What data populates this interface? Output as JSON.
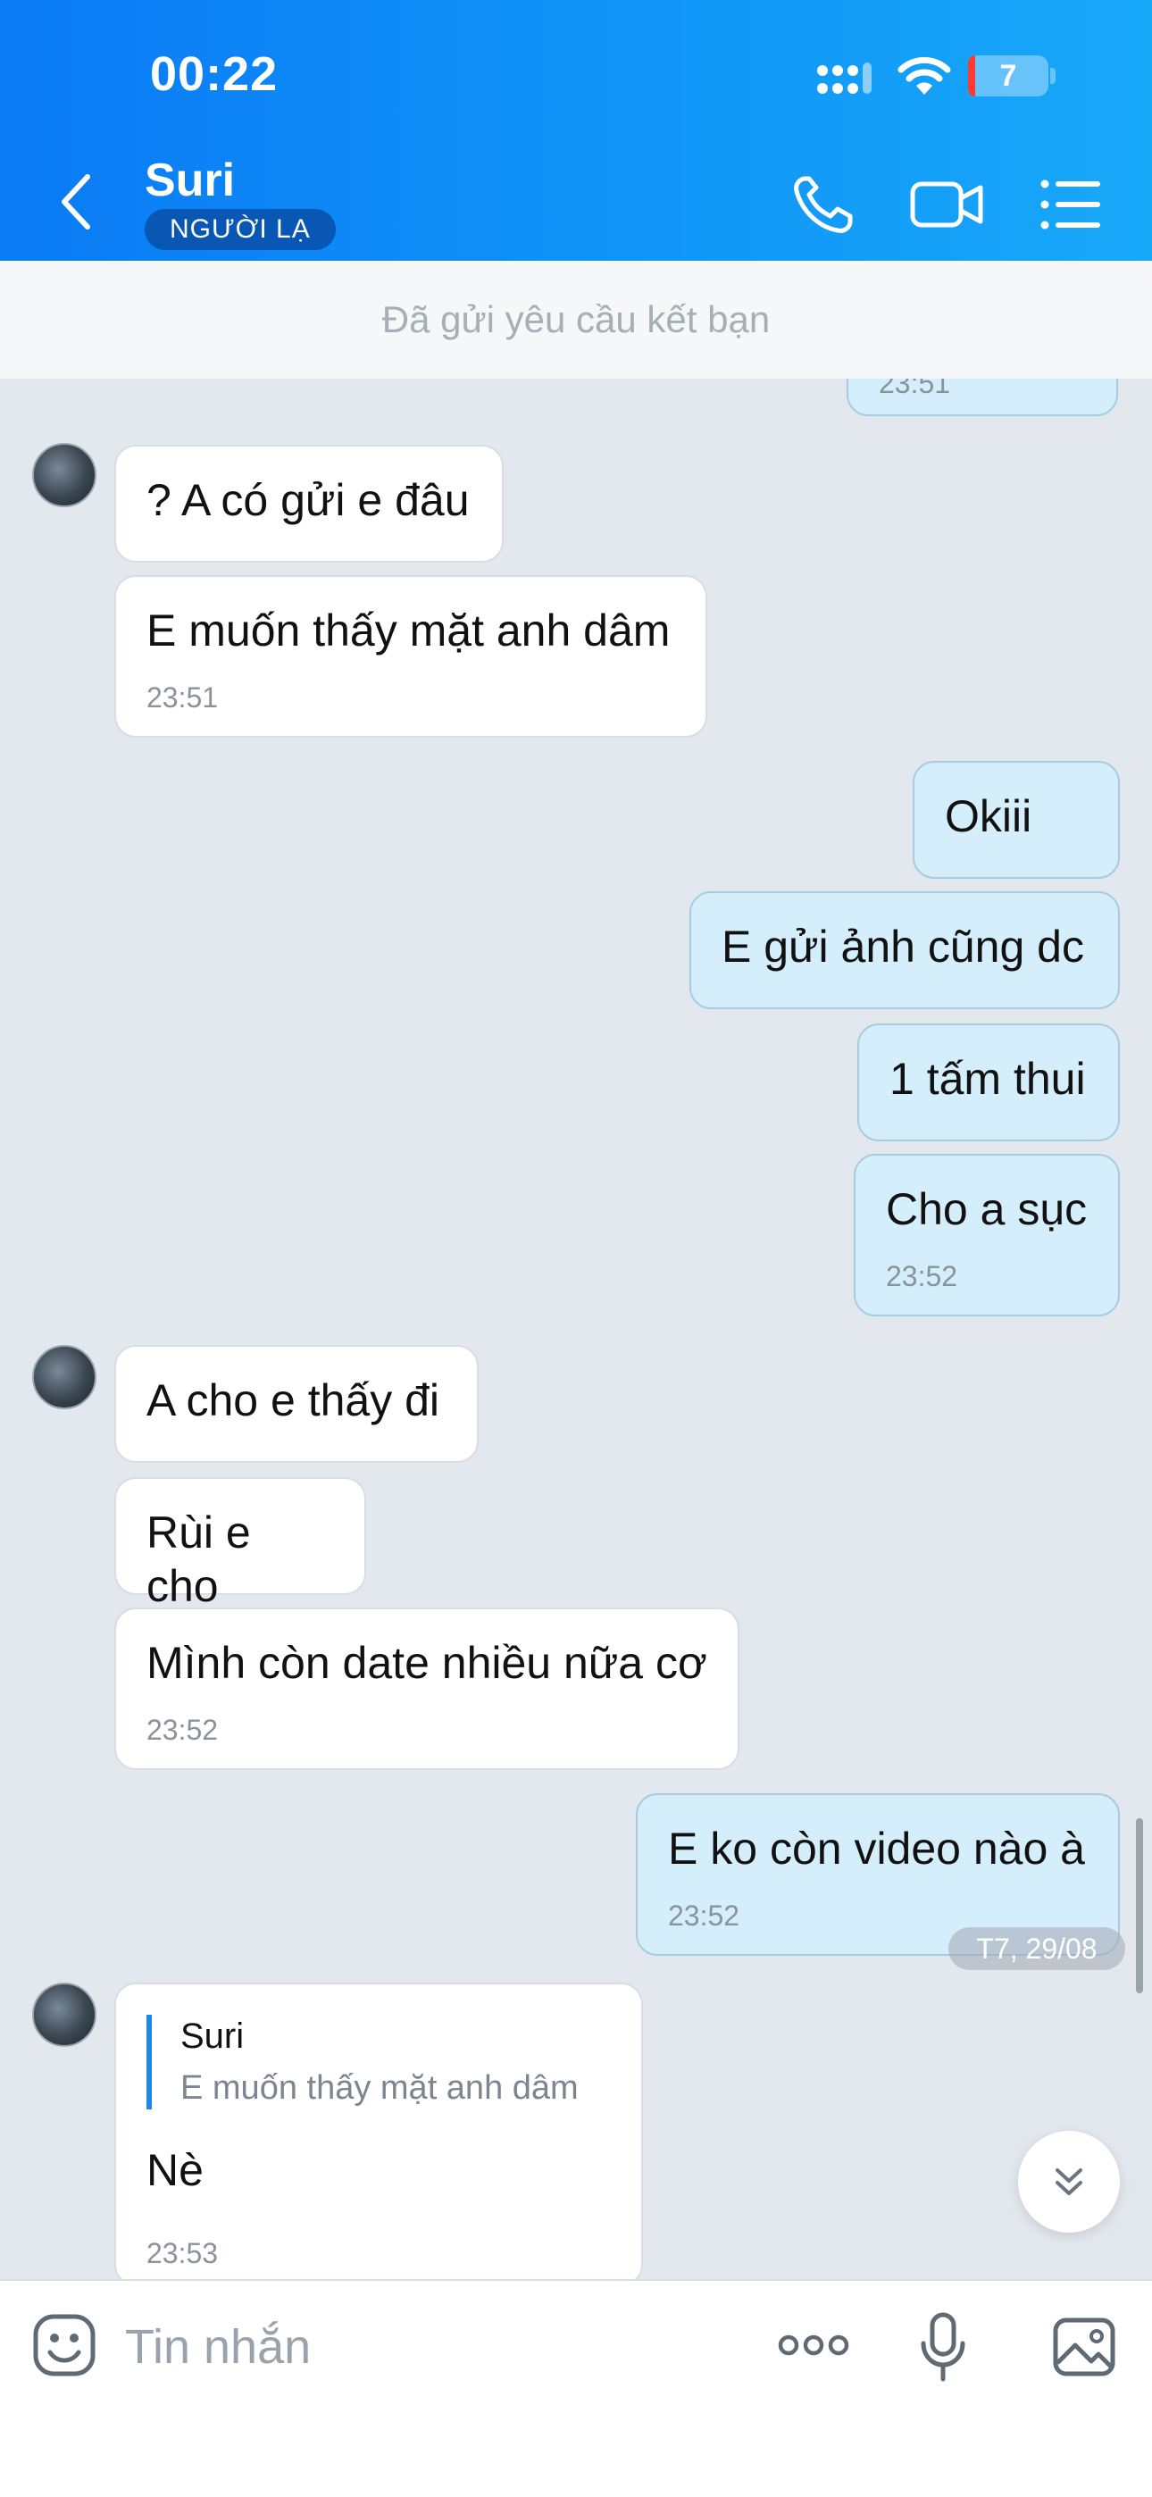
{
  "status_bar": {
    "time": "00:22",
    "battery": "7"
  },
  "header": {
    "name": "Suri",
    "badge": "NGƯỜI LẠ"
  },
  "friend_request": "Đã gửi yêu cầu kết bạn",
  "partial_time": "23:51",
  "messages": [
    {
      "text": "? A có gửi e đâu"
    },
    {
      "text": "E muốn thấy mặt anh dâm",
      "time": "23:51"
    },
    {
      "text": "Okiii"
    },
    {
      "text": "E gửi ảnh cũng dc"
    },
    {
      "text": "1 tấm thui"
    },
    {
      "text": "Cho a sục",
      "time": "23:52"
    },
    {
      "text": "A cho e thấy đi"
    },
    {
      "text": "Rùi e cho"
    },
    {
      "text": "Mình còn date nhiều nữa cơ",
      "time": "23:52"
    },
    {
      "text": "E ko còn video nào à",
      "time": "23:52"
    },
    {
      "reply_name": "Suri",
      "reply_text": "E muốn thấy mặt anh dâm",
      "text": "Nè",
      "time": "23:53"
    }
  ],
  "date_label": "T7, 29/08",
  "composer": {
    "placeholder": "Tin nhắn"
  },
  "icons": {
    "back": "chevron-left-icon",
    "call": "phone-icon",
    "video": "video-camera-icon",
    "menu": "list-menu-icon",
    "emoji": "sticker-icon",
    "more": "more-dots-icon",
    "mic": "microphone-icon",
    "image": "image-icon",
    "scroll": "double-chevron-down-icon"
  },
  "colors": {
    "header": "#0a7af5",
    "outgoing_bubble": "#d5eefc",
    "incoming_bubble": "#ffffff",
    "badge": "#0857b5"
  }
}
